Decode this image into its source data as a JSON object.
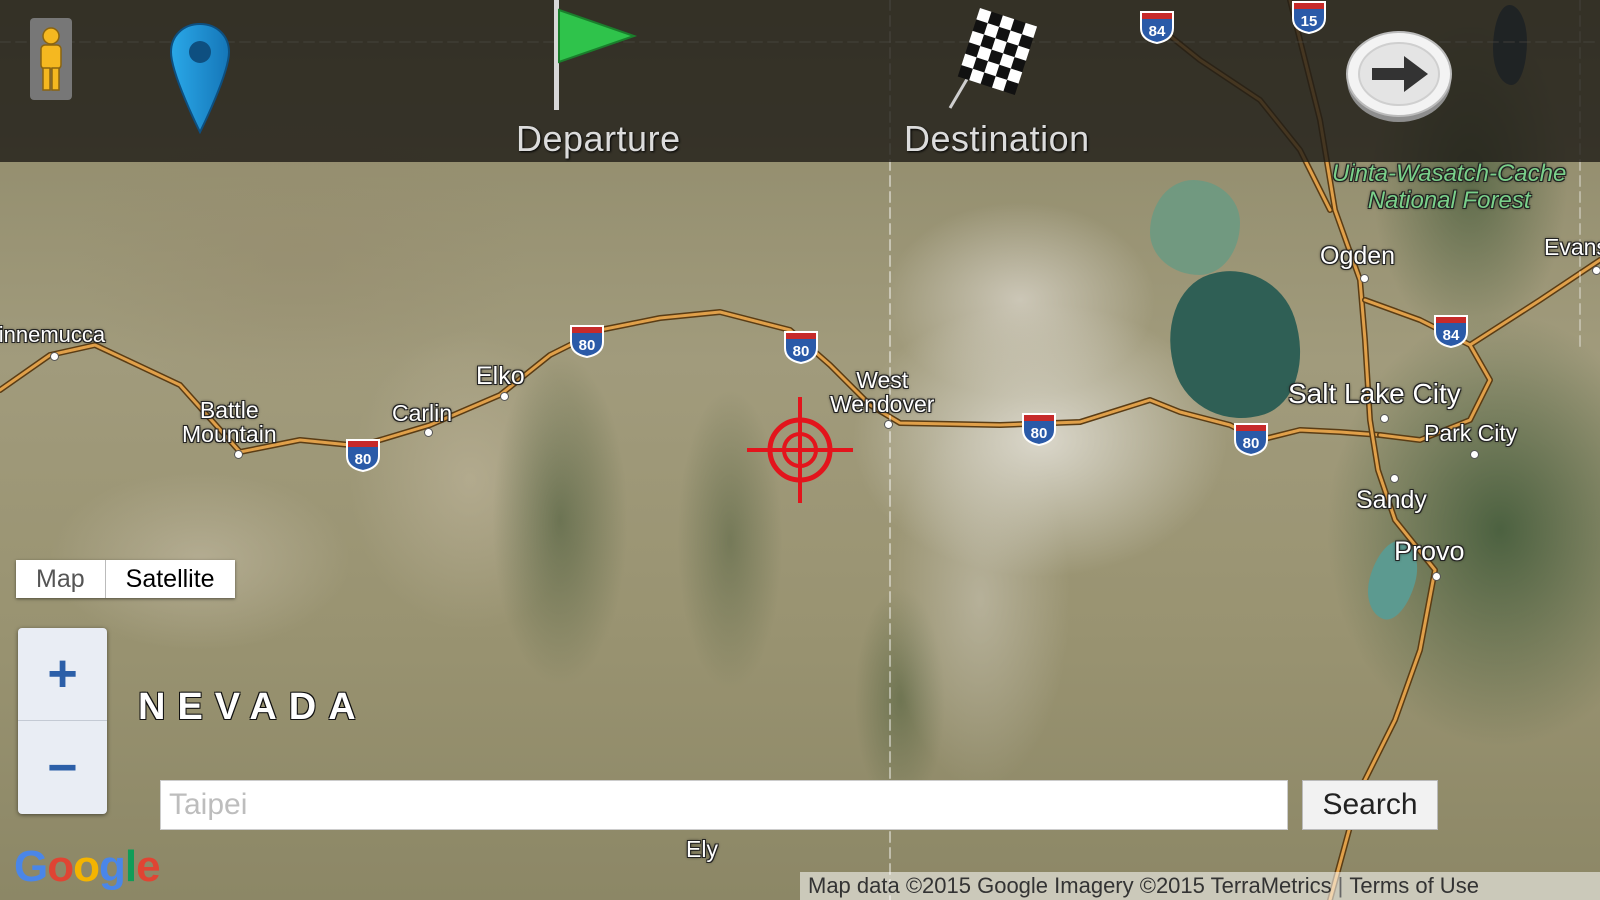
{
  "toolbar": {
    "departure_label": "Departure",
    "destination_label": "Destination",
    "icons": [
      "pegman-icon",
      "map-pin-icon",
      "green-flag-icon",
      "checkered-flag-icon",
      "arrow-right-icon"
    ]
  },
  "map": {
    "state_label": "NEVADA",
    "places": {
      "winnemucca": "Winnemucca",
      "battle_mountain_1": "Battle",
      "battle_mountain_2": "Mountain",
      "carlin": "Carlin",
      "elko": "Elko",
      "west_wendover_1": "West",
      "west_wendover_2": "Wendover",
      "ogden": "Ogden",
      "salt_lake_city": "Salt Lake City",
      "park_city": "Park City",
      "sandy": "Sandy",
      "provo": "Provo",
      "ely": "Ely",
      "evanston": "Evans",
      "forest_1": "Uinta-Wasatch-Cache",
      "forest_2": "National Forest"
    },
    "interstates": {
      "i80": "80",
      "i84": "84",
      "i15": "15"
    }
  },
  "map_type": {
    "map_label": "Map",
    "satellite_label": "Satellite",
    "selected": "Satellite"
  },
  "zoom": {
    "in_label": "+",
    "out_label": "−"
  },
  "search": {
    "placeholder": "Taipei",
    "value": "",
    "button_label": "Search"
  },
  "attribution": {
    "text": "Map data ©2015 Google Imagery ©2015 TerraMetrics",
    "terms": "Terms of Use"
  },
  "logo": "Google",
  "colors": {
    "toolbar_bg": "#1e1b16",
    "road": "#e0a04a",
    "crosshair": "#e3141c",
    "shield_blue": "#2a5aa8",
    "shield_red": "#c62a2a"
  }
}
